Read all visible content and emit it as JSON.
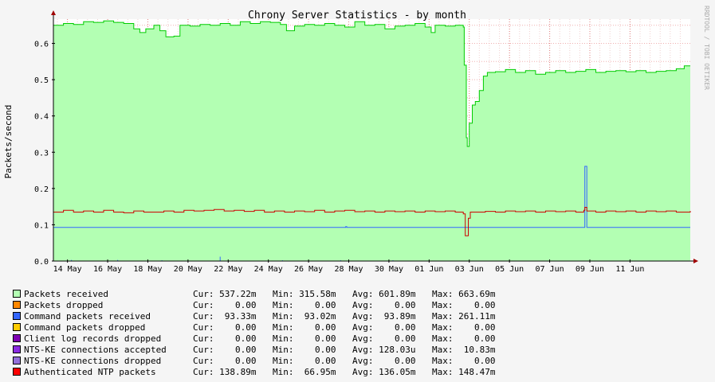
{
  "chart_data": {
    "type": "area",
    "title": "Chrony Server Statistics - by month",
    "ylabel": "Packets/second",
    "watermark": "RRDTOOL / TOBI OETIKER",
    "ylim": [
      0,
      0.667
    ],
    "yticks": [
      0.0,
      0.1,
      0.2,
      0.3,
      0.4,
      0.5,
      0.6
    ],
    "ytick_labels": [
      "0.0",
      "0.1",
      "0.2",
      "0.3",
      "0.4",
      "0.5",
      "0.6"
    ],
    "xlim_days": [
      0,
      31.7
    ],
    "xticks": [
      {
        "day": 0.7,
        "label": "14 May"
      },
      {
        "day": 2.7,
        "label": "16 May"
      },
      {
        "day": 4.7,
        "label": "18 May"
      },
      {
        "day": 6.7,
        "label": "20 May"
      },
      {
        "day": 8.7,
        "label": "22 May"
      },
      {
        "day": 10.7,
        "label": "24 May"
      },
      {
        "day": 12.7,
        "label": "26 May"
      },
      {
        "day": 14.7,
        "label": "28 May"
      },
      {
        "day": 16.7,
        "label": "30 May"
      },
      {
        "day": 18.7,
        "label": "01 Jun"
      },
      {
        "day": 20.7,
        "label": "03 Jun"
      },
      {
        "day": 22.7,
        "label": "05 Jun"
      },
      {
        "day": 24.7,
        "label": "07 Jun"
      },
      {
        "day": 26.7,
        "label": "09 Jun"
      },
      {
        "day": 28.7,
        "label": "11 Jun"
      }
    ],
    "series": [
      {
        "name": "Packets received",
        "color": "#b3ffb3",
        "line_color": "#00cc00",
        "fill": true,
        "points": [
          [
            0,
            0.65
          ],
          [
            0.5,
            0.655
          ],
          [
            1.0,
            0.652
          ],
          [
            1.5,
            0.66
          ],
          [
            2.0,
            0.658
          ],
          [
            2.5,
            0.662
          ],
          [
            3.0,
            0.658
          ],
          [
            3.5,
            0.655
          ],
          [
            4.0,
            0.64
          ],
          [
            4.3,
            0.63
          ],
          [
            4.6,
            0.64
          ],
          [
            5.0,
            0.65
          ],
          [
            5.3,
            0.635
          ],
          [
            5.6,
            0.618
          ],
          [
            6.0,
            0.62
          ],
          [
            6.3,
            0.65
          ],
          [
            6.8,
            0.648
          ],
          [
            7.3,
            0.652
          ],
          [
            7.8,
            0.65
          ],
          [
            8.3,
            0.655
          ],
          [
            8.8,
            0.65
          ],
          [
            9.3,
            0.66
          ],
          [
            9.8,
            0.655
          ],
          [
            10.3,
            0.66
          ],
          [
            10.8,
            0.658
          ],
          [
            11.3,
            0.652
          ],
          [
            11.6,
            0.635
          ],
          [
            12.0,
            0.648
          ],
          [
            12.5,
            0.652
          ],
          [
            13.0,
            0.65
          ],
          [
            13.5,
            0.655
          ],
          [
            14.0,
            0.65
          ],
          [
            14.5,
            0.645
          ],
          [
            15.0,
            0.66
          ],
          [
            15.5,
            0.65
          ],
          [
            16.0,
            0.652
          ],
          [
            16.5,
            0.64
          ],
          [
            17.0,
            0.648
          ],
          [
            17.5,
            0.65
          ],
          [
            18.0,
            0.655
          ],
          [
            18.5,
            0.645
          ],
          [
            18.8,
            0.63
          ],
          [
            19.0,
            0.65
          ],
          [
            19.5,
            0.648
          ],
          [
            20.0,
            0.65
          ],
          [
            20.4,
            0.645
          ],
          [
            20.45,
            0.54
          ],
          [
            20.55,
            0.34
          ],
          [
            20.6,
            0.316
          ],
          [
            20.7,
            0.38
          ],
          [
            20.85,
            0.43
          ],
          [
            21.0,
            0.44
          ],
          [
            21.2,
            0.47
          ],
          [
            21.4,
            0.51
          ],
          [
            21.6,
            0.52
          ],
          [
            22.0,
            0.522
          ],
          [
            22.5,
            0.528
          ],
          [
            23.0,
            0.52
          ],
          [
            23.5,
            0.525
          ],
          [
            24.0,
            0.515
          ],
          [
            24.5,
            0.52
          ],
          [
            25.0,
            0.525
          ],
          [
            25.5,
            0.52
          ],
          [
            26.0,
            0.523
          ],
          [
            26.5,
            0.528
          ],
          [
            27.0,
            0.52
          ],
          [
            27.5,
            0.523
          ],
          [
            28.0,
            0.525
          ],
          [
            28.5,
            0.522
          ],
          [
            29.0,
            0.525
          ],
          [
            29.5,
            0.52
          ],
          [
            30.0,
            0.523
          ],
          [
            30.5,
            0.525
          ],
          [
            31.0,
            0.53
          ],
          [
            31.4,
            0.538
          ],
          [
            31.7,
            0.538
          ]
        ]
      },
      {
        "name": "Command packets received",
        "color": "#3366ff",
        "line_color": "#3366ff",
        "fill": false,
        "points": [
          [
            0,
            0.0925
          ],
          [
            14.5,
            0.0925
          ],
          [
            14.55,
            0.095
          ],
          [
            14.6,
            0.0925
          ],
          [
            26.4,
            0.0925
          ],
          [
            26.45,
            0.261
          ],
          [
            26.5,
            0.261
          ],
          [
            26.55,
            0.0925
          ],
          [
            31.7,
            0.0925
          ]
        ]
      },
      {
        "name": "Authenticated NTP packets",
        "color": "#ff0000",
        "line_color": "#cc0000",
        "fill": false,
        "points": [
          [
            0,
            0.135
          ],
          [
            0.5,
            0.14
          ],
          [
            1.0,
            0.135
          ],
          [
            1.5,
            0.138
          ],
          [
            2.0,
            0.135
          ],
          [
            2.5,
            0.14
          ],
          [
            3.0,
            0.135
          ],
          [
            3.5,
            0.133
          ],
          [
            4.0,
            0.138
          ],
          [
            4.5,
            0.135
          ],
          [
            5.0,
            0.135
          ],
          [
            5.5,
            0.138
          ],
          [
            6.0,
            0.135
          ],
          [
            6.5,
            0.14
          ],
          [
            7.0,
            0.138
          ],
          [
            7.5,
            0.14
          ],
          [
            8.0,
            0.142
          ],
          [
            8.5,
            0.138
          ],
          [
            9.0,
            0.14
          ],
          [
            9.5,
            0.137
          ],
          [
            10.0,
            0.14
          ],
          [
            10.5,
            0.135
          ],
          [
            11.0,
            0.138
          ],
          [
            11.5,
            0.135
          ],
          [
            12.0,
            0.138
          ],
          [
            12.5,
            0.136
          ],
          [
            13.0,
            0.14
          ],
          [
            13.5,
            0.135
          ],
          [
            14.0,
            0.138
          ],
          [
            14.5,
            0.14
          ],
          [
            15.0,
            0.136
          ],
          [
            15.5,
            0.138
          ],
          [
            16.0,
            0.135
          ],
          [
            16.5,
            0.138
          ],
          [
            17.0,
            0.136
          ],
          [
            17.5,
            0.138
          ],
          [
            18.0,
            0.135
          ],
          [
            18.5,
            0.138
          ],
          [
            19.0,
            0.136
          ],
          [
            19.5,
            0.138
          ],
          [
            20.0,
            0.135
          ],
          [
            20.4,
            0.13
          ],
          [
            20.5,
            0.0695
          ],
          [
            20.6,
            0.0695
          ],
          [
            20.65,
            0.118
          ],
          [
            20.75,
            0.135
          ],
          [
            21.0,
            0.135
          ],
          [
            21.5,
            0.137
          ],
          [
            22.0,
            0.135
          ],
          [
            22.5,
            0.138
          ],
          [
            23.0,
            0.136
          ],
          [
            23.5,
            0.138
          ],
          [
            24.0,
            0.135
          ],
          [
            24.5,
            0.138
          ],
          [
            25.0,
            0.136
          ],
          [
            25.5,
            0.138
          ],
          [
            26.0,
            0.135
          ],
          [
            26.4,
            0.14
          ],
          [
            26.45,
            0.148
          ],
          [
            26.55,
            0.138
          ],
          [
            27.0,
            0.135
          ],
          [
            27.5,
            0.138
          ],
          [
            28.0,
            0.136
          ],
          [
            28.5,
            0.138
          ],
          [
            29.0,
            0.135
          ],
          [
            29.5,
            0.138
          ],
          [
            30.0,
            0.136
          ],
          [
            30.5,
            0.138
          ],
          [
            31.0,
            0.135
          ],
          [
            31.7,
            0.138
          ]
        ]
      }
    ]
  },
  "legend": [
    {
      "name": "Packets received",
      "color": "#b3ffb3",
      "cur": "537.22m",
      "min": "315.58m",
      "avg": "601.89m",
      "max": "663.69m"
    },
    {
      "name": "Packets dropped",
      "color": "#ff8800",
      "cur": "0.00",
      "min": "0.00",
      "avg": "0.00",
      "max": "0.00"
    },
    {
      "name": "Command packets received",
      "color": "#3366ff",
      "cur": "93.33m",
      "min": "93.02m",
      "avg": "93.89m",
      "max": "261.11m"
    },
    {
      "name": "Command packets dropped",
      "color": "#ffcc00",
      "cur": "0.00",
      "min": "0.00",
      "avg": "0.00",
      "max": "0.00"
    },
    {
      "name": "Client log records dropped",
      "color": "#7f00b3",
      "cur": "0.00",
      "min": "0.00",
      "avg": "0.00",
      "max": "0.00"
    },
    {
      "name": "NTS-KE connections accepted",
      "color": "#8a2be2",
      "cur": "0.00",
      "min": "0.00",
      "avg": "128.03u",
      "max": "10.83m"
    },
    {
      "name": "NTS-KE connections dropped",
      "color": "#9370db",
      "cur": "0.00",
      "min": "0.00",
      "avg": "0.00",
      "max": "0.00"
    },
    {
      "name": "Authenticated NTP packets",
      "color": "#ff0000",
      "cur": "138.89m",
      "min": "66.95m",
      "avg": "136.05m",
      "max": "148.47m"
    }
  ],
  "legend_labels": {
    "cur": "Cur:",
    "min": "Min:",
    "avg": "Avg:",
    "max": "Max:"
  }
}
